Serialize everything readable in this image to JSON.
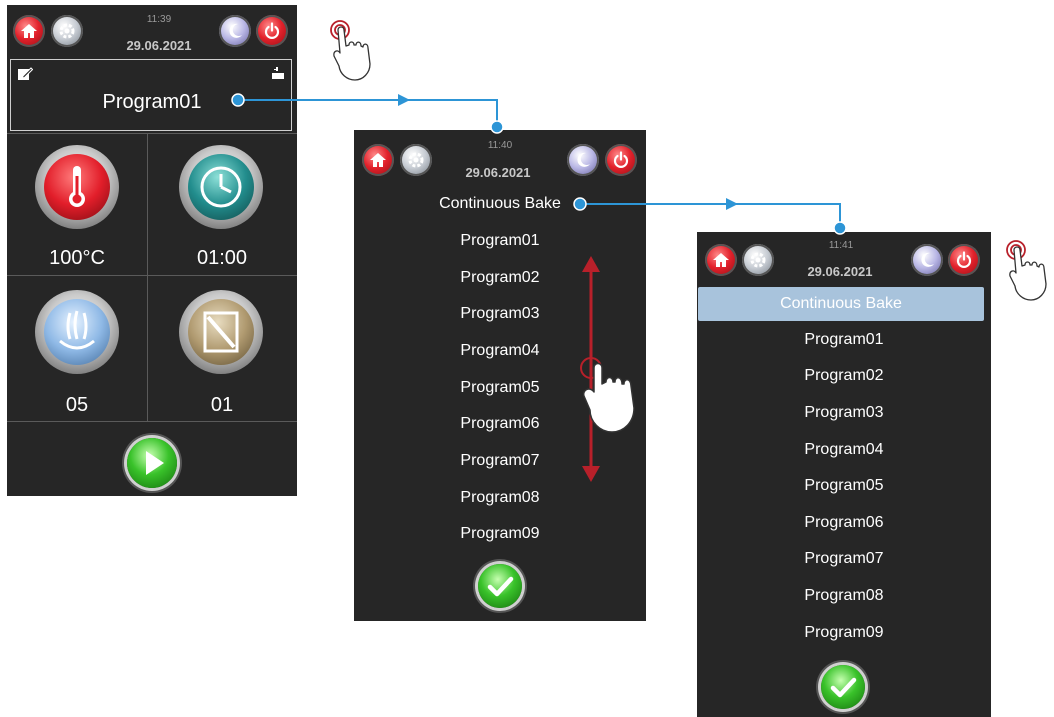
{
  "screen1": {
    "time": "11:39",
    "date": "29.06.2021",
    "program_name": "Program01",
    "temperature": "100°C",
    "duration": "01:00",
    "steam": "05",
    "damper": "01"
  },
  "screen2": {
    "time": "11:40",
    "date": "29.06.2021",
    "items": [
      "Continuous Bake",
      "Program01",
      "Program02",
      "Program03",
      "Program04",
      "Program05",
      "Program06",
      "Program07",
      "Program08",
      "Program09"
    ]
  },
  "screen3": {
    "time": "11:41",
    "date": "29.06.2021",
    "selected": "Continuous Bake",
    "items": [
      "Program01",
      "Program02",
      "Program03",
      "Program04",
      "Program05",
      "Program06",
      "Program07",
      "Program08",
      "Program09"
    ]
  },
  "icons": [
    "home-icon",
    "gear-icon",
    "moon-icon",
    "power-icon",
    "edit-icon",
    "usb-icon",
    "thermometer-icon",
    "clock-icon",
    "steam-icon",
    "damper-icon",
    "play-icon",
    "checkmark-icon",
    "tap-hand-icon",
    "scroll-hand-icon"
  ],
  "colors": {
    "panel": "#262626",
    "accent_blue": "#2d95d6",
    "scroll_red": "#b8202a",
    "selection": "#a8c3dc"
  }
}
